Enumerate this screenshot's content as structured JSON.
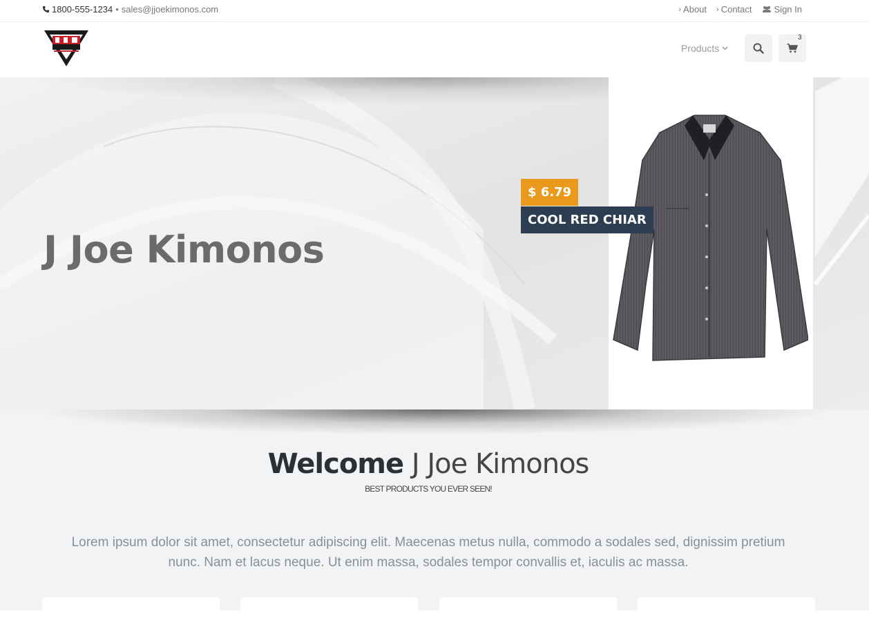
{
  "topbar": {
    "phone": "1800-555-1234",
    "separator": "•",
    "email": "sales@jjoekimonos.com",
    "links": [
      {
        "label": "About"
      },
      {
        "label": "Contact"
      },
      {
        "label": "Sign In"
      }
    ]
  },
  "header": {
    "nav_products_label": "Products",
    "cart_count": "3",
    "icons": [
      "search-icon",
      "shopping-cart-icon",
      "chevron-down-icon"
    ]
  },
  "hero": {
    "title": "J Joe Kimonos",
    "price": "$ 6.79",
    "product_name": "COOL RED CHIAR"
  },
  "welcome": {
    "title_bold": "Welcome",
    "title_light": "J Joe Kimonos",
    "subtitle": "BEST PRODUCTS YOU EVER SEEN!",
    "body": "Lorem ipsum dolor sit amet, consectetur adipiscing elit. Maecenas metus nulla, commodo a sodales sed, dignissim pretium nunc. Nam et lacus neque. Ut enim massa, sodales tempor convallis et, iaculis ac massa."
  },
  "colors": {
    "price_tag": "#e99a1d",
    "product_name_bg": "#2e3e52",
    "hero_title": "#6b6b6b"
  }
}
